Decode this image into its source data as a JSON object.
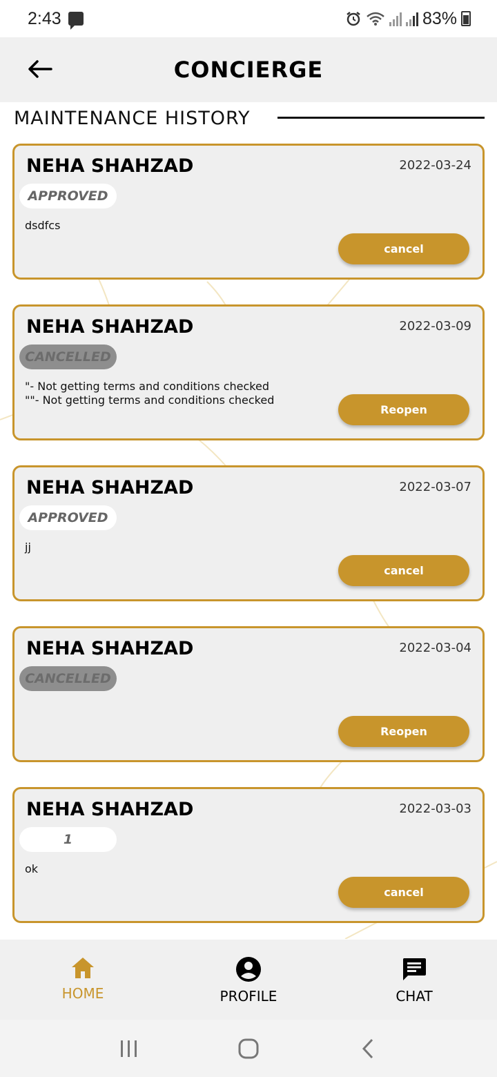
{
  "status_bar": {
    "time": "2:43",
    "battery": "83%"
  },
  "header": {
    "title": "CONCIERGE",
    "back_icon": "arrow-left-icon"
  },
  "section": {
    "title": "MAINTENANCE HISTORY"
  },
  "cards": [
    {
      "name": "NEHA SHAHZAD",
      "date": "2022-03-24",
      "status": "APPROVED",
      "status_kind": "approved",
      "description": "dsdfcs",
      "action": "cancel"
    },
    {
      "name": "NEHA SHAHZAD",
      "date": "2022-03-09",
      "status": "CANCELLED",
      "status_kind": "cancelled",
      "description": "\"- Not getting terms and conditions checked\n\"\"- Not getting terms and conditions checked",
      "action": "Reopen"
    },
    {
      "name": "NEHA SHAHZAD",
      "date": "2022-03-07",
      "status": "APPROVED",
      "status_kind": "approved",
      "description": "jj",
      "action": "cancel"
    },
    {
      "name": "NEHA SHAHZAD",
      "date": "2022-03-04",
      "status": "CANCELLED",
      "status_kind": "cancelled",
      "description": "",
      "action": "Reopen"
    },
    {
      "name": "NEHA SHAHZAD",
      "date": "2022-03-03",
      "status": "1",
      "status_kind": "other",
      "description": "ok",
      "action": "cancel"
    }
  ],
  "bottom_nav": {
    "items": [
      {
        "label": "HOME",
        "icon": "home-icon",
        "active": true
      },
      {
        "label": "PROFILE",
        "icon": "account-circle-icon",
        "active": false
      },
      {
        "label": "CHAT",
        "icon": "chat-icon",
        "active": false
      }
    ]
  },
  "colors": {
    "accent": "#c8952c",
    "card_bg": "#efefef",
    "header_bg": "#f0f0f0",
    "cancelled_pill": "#8e8e8e"
  }
}
